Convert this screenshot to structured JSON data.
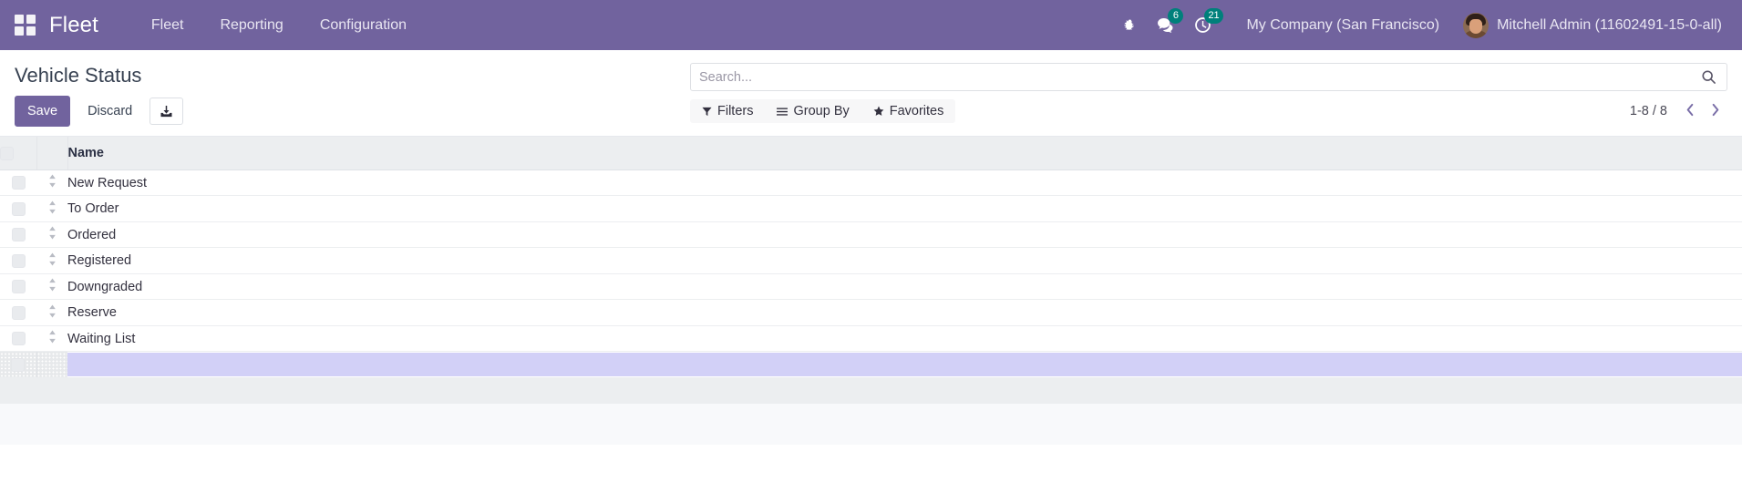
{
  "navbar": {
    "apps_icon": "apps-grid-icon",
    "brand": "Fleet",
    "menu": [
      {
        "label": "Fleet"
      },
      {
        "label": "Reporting"
      },
      {
        "label": "Configuration"
      }
    ],
    "icons": [
      {
        "name": "bug-icon",
        "badge": null
      },
      {
        "name": "messages-icon",
        "badge": "6"
      },
      {
        "name": "activities-clock-icon",
        "badge": "21"
      }
    ],
    "company": "My Company (San Francisco)",
    "user": "Mitchell Admin (11602491-15-0-all)",
    "colors": {
      "navbar_bg": "#71639e",
      "badge_bg": "#00807b"
    }
  },
  "control_panel": {
    "title": "Vehicle Status",
    "save_label": "Save",
    "discard_label": "Discard",
    "export_icon": "download-import-icon",
    "primary_color": "#71639e"
  },
  "search": {
    "placeholder": "Search...",
    "value": "",
    "search_icon": "search-icon"
  },
  "filters": {
    "filters_label": "Filters",
    "filters_icon": "filter-funnel-icon",
    "group_by_label": "Group By",
    "group_by_icon": "bars-icon",
    "favorites_label": "Favorites",
    "favorites_icon": "star-icon"
  },
  "pager": {
    "range": "1-8 / 8",
    "prev_icon": "chevron-left-icon",
    "next_icon": "chevron-right-icon"
  },
  "list": {
    "columns": [
      "Name"
    ],
    "rows": [
      {
        "name": "New Request"
      },
      {
        "name": "To Order"
      },
      {
        "name": "Ordered"
      },
      {
        "name": "Registered"
      },
      {
        "name": "Downgraded"
      },
      {
        "name": "Reserve"
      },
      {
        "name": "Waiting List"
      }
    ],
    "new_row": {
      "name_value": "",
      "name_placeholder": ""
    },
    "handle_icon": "drag-handle-icon",
    "checkbox_icon": "checkbox-icon"
  }
}
